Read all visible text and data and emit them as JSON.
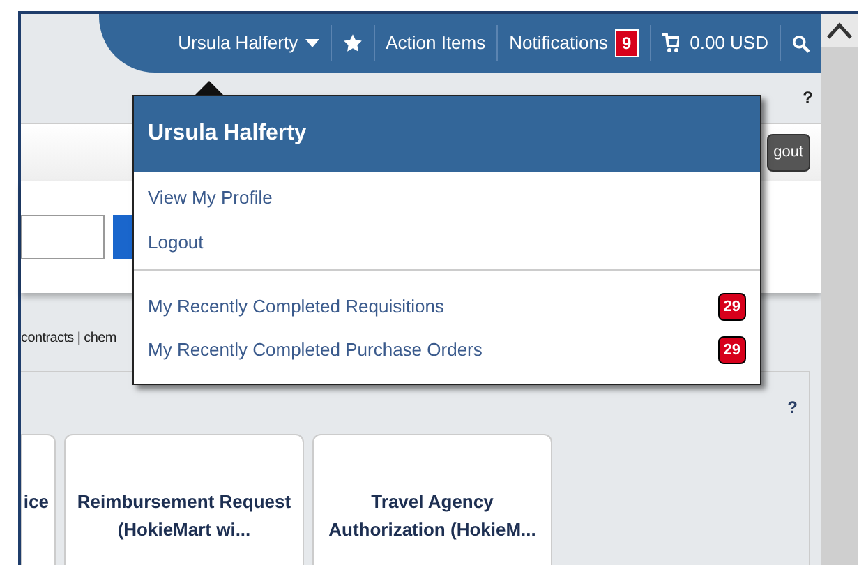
{
  "header": {
    "user_name": "Ursula Halferty",
    "action_items": "Action Items",
    "notifications": {
      "label": "Notifications",
      "count": "9"
    },
    "cart_total": "0.00 USD"
  },
  "user_menu": {
    "title": "Ursula Halferty",
    "links": [
      "View My Profile",
      "Logout"
    ],
    "recent": [
      {
        "label": "My Recently Completed Requisitions",
        "count": "29"
      },
      {
        "label": "My Recently Completed Purchase Orders",
        "count": "29"
      }
    ]
  },
  "page": {
    "help": "?",
    "logout_button": "gout",
    "category_links": "contracts | chem",
    "panel_help": "?",
    "cards": [
      "ice",
      "Reimbursement Request (HokieMart wi...",
      "Travel Agency Authorization (HokieM..."
    ]
  }
}
